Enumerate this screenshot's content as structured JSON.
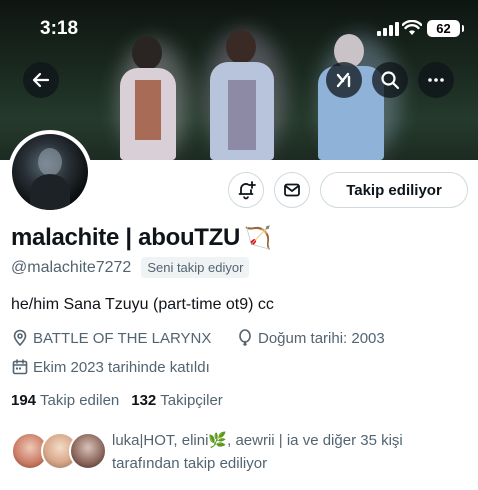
{
  "status_bar": {
    "time": "3:18",
    "battery": "62"
  },
  "header": {
    "back_icon": "arrow-left-icon",
    "grok_icon": "grok-icon",
    "search_icon": "search-icon",
    "more_icon": "more-dots-icon"
  },
  "actions": {
    "notify_icon": "bell-plus-icon",
    "message_icon": "envelope-icon",
    "follow_label": "Takip ediliyor"
  },
  "profile": {
    "name": "malachite | abouTZU",
    "name_emoji": "🏹",
    "handle": "@malachite7272",
    "follows_you": "Seni takip ediyor",
    "bio": "he/him Sana Tzuyu (part-time ot9) cc",
    "location": "BATTLE OF THE LARYNX",
    "birthday": "Doğum tarihi: 2003",
    "joined": "Ekim 2023 tarihinde katıldı"
  },
  "stats": {
    "following_count": "194",
    "following_label": "Takip edilen",
    "followers_count": "132",
    "followers_label": "Takipçiler"
  },
  "mutuals": {
    "line1": "luka|HOT, elini🌿, aewrii | ia ve diğer 35 kişi",
    "line2": "tarafından takip ediliyor"
  },
  "colors": {
    "text_primary": "#0f1419",
    "text_secondary": "#536471",
    "border": "#cfd9de"
  }
}
